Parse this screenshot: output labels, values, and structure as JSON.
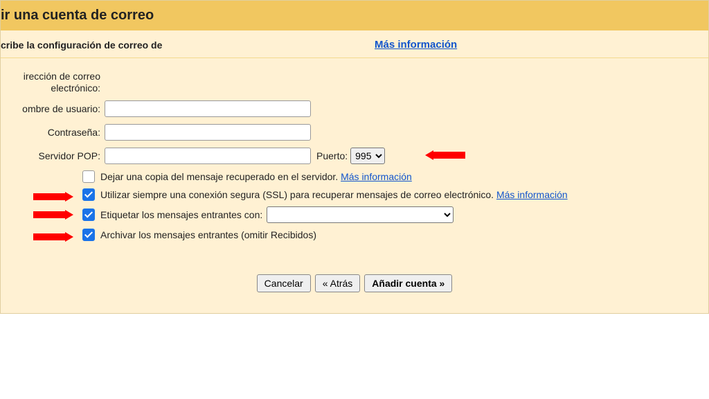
{
  "title": "ir una cuenta de correo",
  "subtitle": "cribe la configuración de correo de",
  "more_info": "Más información",
  "labels": {
    "email": "irección de correo electrónico:",
    "user": "ombre de usuario:",
    "password": "Contraseña:",
    "pop": "Servidor POP:",
    "port": "Puerto:"
  },
  "port_value": "995",
  "checks": {
    "leave_copy": "Dejar una copia del mensaje recuperado en el servidor.",
    "leave_copy_link": "Más información",
    "ssl": "Utilizar siempre una conexión segura (SSL) para recuperar mensajes de correo electrónico.",
    "ssl_link": "Más información",
    "label_msgs": "Etiquetar los mensajes entrantes con:",
    "archive": "Archivar los mensajes entrantes (omitir Recibidos)"
  },
  "buttons": {
    "cancel": "Cancelar",
    "back": "« Atrás",
    "add": "Añadir cuenta »"
  }
}
